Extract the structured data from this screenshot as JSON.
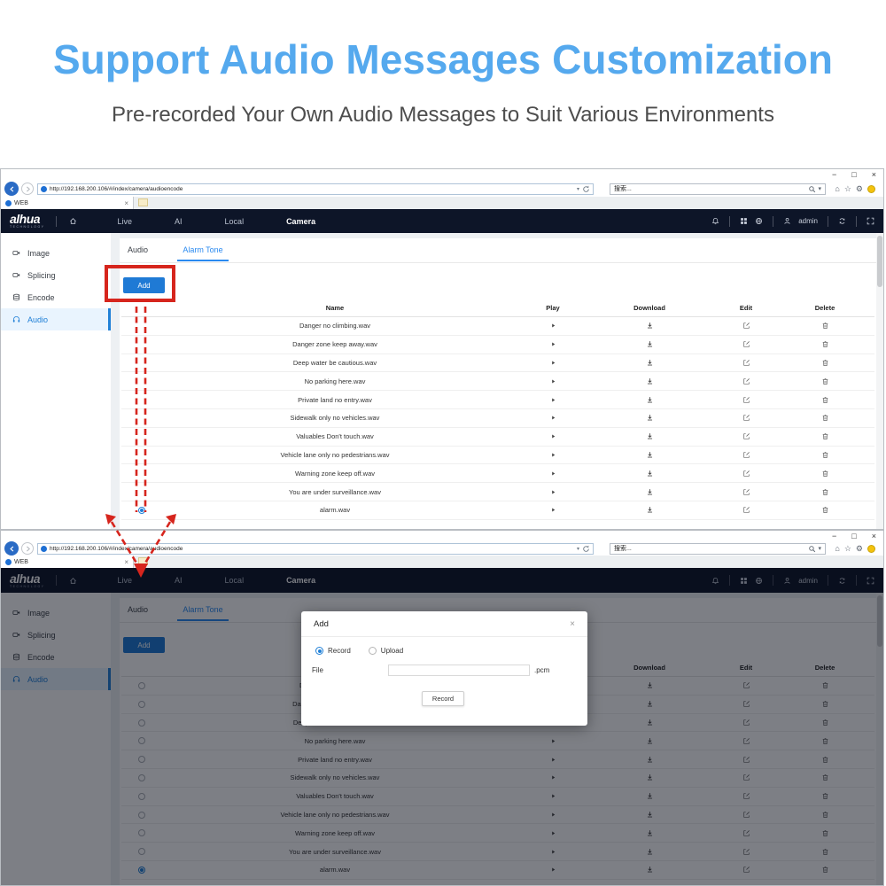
{
  "hero": {
    "title": "Support Audio Messages Customization",
    "subtitle": "Pre-recorded Your Own Audio Messages to Suit Various Environments"
  },
  "browser": {
    "url": "http://192.168.200.106/#/index/camera/audioencode",
    "search_text": "搜索...",
    "tab_title": "WEB"
  },
  "glyphs": {
    "minimize": "−",
    "maximize": "□",
    "close": "×",
    "tab_close": "×",
    "dialog_close": "×",
    "home": "⌂",
    "star": "☆",
    "gear": "⚙",
    "caret": "▾"
  },
  "navbar": {
    "logo_text": "alhua",
    "logo_sub": "TECHNOLOGY",
    "items": [
      {
        "label": "Live"
      },
      {
        "label": "AI"
      },
      {
        "label": "Local"
      },
      {
        "label": "Camera",
        "active": true
      }
    ],
    "user": "admin"
  },
  "sidebar": {
    "items": [
      {
        "label": "Image"
      },
      {
        "label": "Splicing"
      },
      {
        "label": "Encode"
      },
      {
        "label": "Audio",
        "active": true
      }
    ]
  },
  "content": {
    "tabs": [
      {
        "label": "Audio"
      },
      {
        "label": "Alarm Tone",
        "active": true
      }
    ],
    "add_button": "Add",
    "table": {
      "columns": [
        "Name",
        "Play",
        "Download",
        "Edit",
        "Delete"
      ],
      "rows": [
        {
          "name": "Danger no climbing.wav"
        },
        {
          "name": "Danger zone keep away.wav"
        },
        {
          "name": "Deep water be cautious.wav"
        },
        {
          "name": "No parking here.wav"
        },
        {
          "name": "Private land no entry.wav"
        },
        {
          "name": "Sidewalk only no vehicles.wav"
        },
        {
          "name": "Valuables Don't touch.wav"
        },
        {
          "name": "Vehicle lane only no pedestrians.wav"
        },
        {
          "name": "Warning zone keep off.wav"
        },
        {
          "name": "You are under surveillance.wav"
        },
        {
          "name": "alarm.wav",
          "selected": true
        }
      ]
    }
  },
  "dialog": {
    "title": "Add",
    "radio_record": "Record",
    "radio_upload": "Upload",
    "file_label": "File",
    "file_suffix": ".pcm",
    "record_button": "Record"
  },
  "colors": {
    "hero_blue": "#55a9ee",
    "accent_blue": "#2080d7",
    "tab_active_blue": "#2a8af0",
    "navbar_dark": "#0d1528",
    "highlight_red": "#d6251d"
  }
}
